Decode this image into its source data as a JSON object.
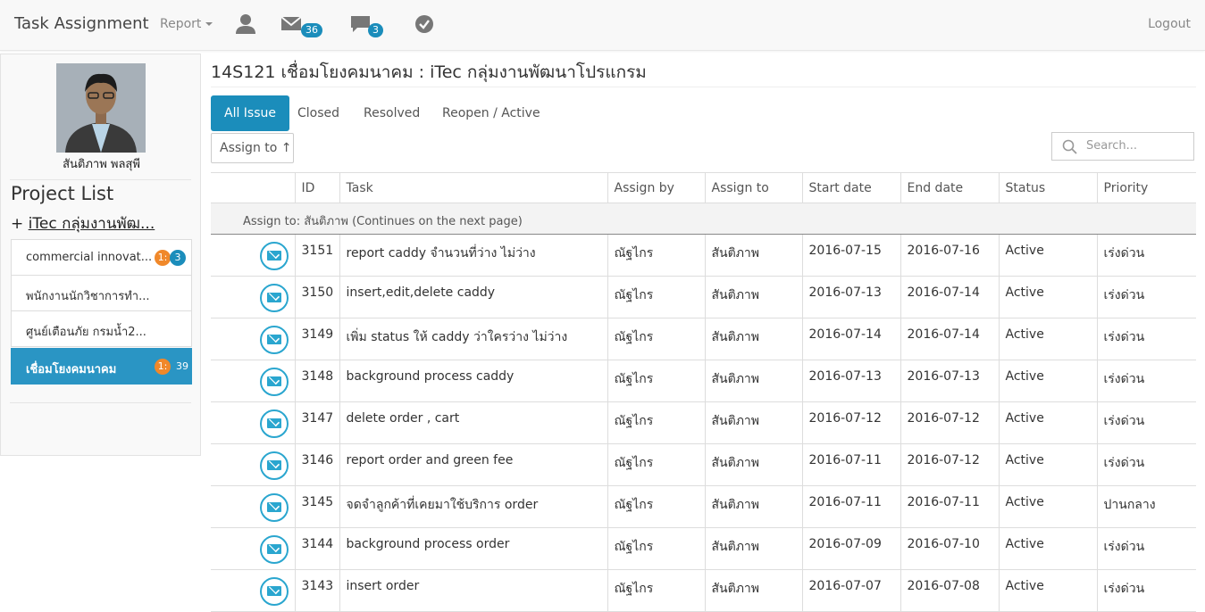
{
  "navbar": {
    "brand": "Task Assignment",
    "report_label": "Report",
    "icons": [
      {
        "name": "user-icon"
      },
      {
        "name": "mail-icon",
        "badge": "36"
      },
      {
        "name": "chat-icon",
        "badge": "3"
      },
      {
        "name": "check-circle-icon"
      }
    ],
    "logout_label": "Logout"
  },
  "sidebar": {
    "user_name": "สันติภาพ พลสุพี",
    "project_list_title": "Project List",
    "project_group_prefix": "+",
    "project_group_name": "iTec กลุ่มงานพัฒ...",
    "projects": [
      {
        "name": "commercial innovat...",
        "badge_orange": "1:",
        "badge_blue": "3",
        "active": false
      },
      {
        "name": "พนักงานนักวิชาการทำ...",
        "active": false
      },
      {
        "name": "ศูนย์เตือนภัย กรมน้ำ2...",
        "active": false
      },
      {
        "name": "เชื่อมโยงคมนาคม",
        "badge_orange": "1:",
        "badge_blue": "39",
        "active": true
      }
    ]
  },
  "main": {
    "title": "14S121 เชื่อมโยงคมนาคม : iTec กลุ่มงานพัฒนาโปรแกรม",
    "tabs": [
      {
        "label": "All Issue",
        "active": true
      },
      {
        "label": "Closed",
        "active": false
      },
      {
        "label": "Resolved",
        "active": false
      },
      {
        "label": "Reopen / Active",
        "active": false
      }
    ],
    "assign_button": "Assign to ↑",
    "search_placeholder": "Search...",
    "columns": [
      "",
      "ID",
      "Task",
      "Assign by",
      "Assign to",
      "Start date",
      "End date",
      "Status",
      "Priority"
    ],
    "group_label": "Assign to: สันติภาพ (Continues on the next page)",
    "rows": [
      {
        "id": "3151",
        "task": "report caddy จำนวนที่ว่าง ไม่ว่าง",
        "by": "ณัฐไกร",
        "to": "สันติภาพ",
        "start": "2016-07-15",
        "end": "2016-07-16",
        "status": "Active",
        "priority": "เร่งด่วน"
      },
      {
        "id": "3150",
        "task": "insert,edit,delete caddy",
        "by": "ณัฐไกร",
        "to": "สันติภาพ",
        "start": "2016-07-13",
        "end": "2016-07-14",
        "status": "Active",
        "priority": "เร่งด่วน"
      },
      {
        "id": "3149",
        "task": "เพิ่ม status ให้ caddy ว่าใครว่าง ไม่ว่าง",
        "by": "ณัฐไกร",
        "to": "สันติภาพ",
        "start": "2016-07-14",
        "end": "2016-07-14",
        "status": "Active",
        "priority": "เร่งด่วน"
      },
      {
        "id": "3148",
        "task": "background process caddy",
        "by": "ณัฐไกร",
        "to": "สันติภาพ",
        "start": "2016-07-13",
        "end": "2016-07-13",
        "status": "Active",
        "priority": "เร่งด่วน"
      },
      {
        "id": "3147",
        "task": "delete order , cart",
        "by": "ณัฐไกร",
        "to": "สันติภาพ",
        "start": "2016-07-12",
        "end": "2016-07-12",
        "status": "Active",
        "priority": "เร่งด่วน"
      },
      {
        "id": "3146",
        "task": "report order and green fee",
        "by": "ณัฐไกร",
        "to": "สันติภาพ",
        "start": "2016-07-11",
        "end": "2016-07-12",
        "status": "Active",
        "priority": "เร่งด่วน"
      },
      {
        "id": "3145",
        "task": "จดจำลูกค้าที่เคยมาใช้บริการ order",
        "by": "ณัฐไกร",
        "to": "สันติภาพ",
        "start": "2016-07-11",
        "end": "2016-07-11",
        "status": "Active",
        "priority": "ปานกลาง"
      },
      {
        "id": "3144",
        "task": "background process order",
        "by": "ณัฐไกร",
        "to": "สันติภาพ",
        "start": "2016-07-09",
        "end": "2016-07-10",
        "status": "Active",
        "priority": "เร่งด่วน"
      },
      {
        "id": "3143",
        "task": "insert order",
        "by": "ณัฐไกร",
        "to": "สันติภาพ",
        "start": "2016-07-07",
        "end": "2016-07-08",
        "status": "Active",
        "priority": "เร่งด่วน"
      }
    ]
  }
}
